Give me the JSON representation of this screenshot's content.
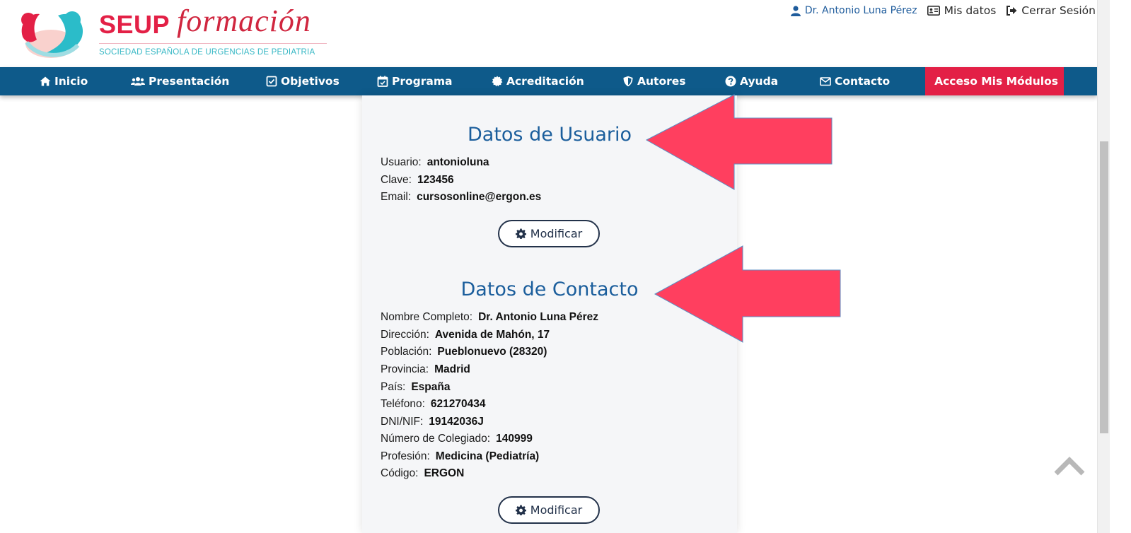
{
  "colors": {
    "brand_red": "#e32046",
    "nav_blue": "#0e5a8a",
    "title_blue": "#1b5e9c",
    "teal": "#35b7c4",
    "annotation_arrow": "#ff3f5f"
  },
  "logo": {
    "main": "SEUP",
    "script": "formación",
    "subtitle": "SOCIEDAD ESPAÑOLA DE URGENCIAS DE PEDIATRIA"
  },
  "user_bar": {
    "user_name": "Dr. Antonio Luna Pérez",
    "mis_datos": "Mis datos",
    "cerrar_sesion": "Cerrar Sesión",
    "icons": [
      "user-icon",
      "id-card-icon",
      "sign-out-icon"
    ]
  },
  "nav": {
    "items": [
      {
        "label": "Inicio",
        "icon": "home-icon"
      },
      {
        "label": "Presentación",
        "icon": "users-icon"
      },
      {
        "label": "Objetivos",
        "icon": "check-square-icon"
      },
      {
        "label": "Programa",
        "icon": "calendar-check-icon"
      },
      {
        "label": "Acreditación",
        "icon": "certificate-icon"
      },
      {
        "label": "Autores",
        "icon": "shield-icon"
      },
      {
        "label": "Ayuda",
        "icon": "question-circle-icon"
      },
      {
        "label": "Contacto",
        "icon": "envelope-icon"
      },
      {
        "label": "Acceso Mis Módulos",
        "icon": "hand-pointer-icon"
      }
    ]
  },
  "user_data": {
    "title": "Datos de Usuario",
    "fields": [
      {
        "label": "Usuario:",
        "value": "antonioluna"
      },
      {
        "label": "Clave:",
        "value": "123456"
      },
      {
        "label": "Email:",
        "value": "cursosonline@ergon.es"
      }
    ],
    "button": "Modificar"
  },
  "contact_data": {
    "title": "Datos de Contacto",
    "fields": [
      {
        "label": "Nombre Completo:",
        "value": "Dr. Antonio Luna Pérez"
      },
      {
        "label": "Dirección:",
        "value": "Avenida de Mahón, 17"
      },
      {
        "label": "Población:",
        "value": "Pueblonuevo (28320)"
      },
      {
        "label": "Provincia:",
        "value": "Madrid"
      },
      {
        "label": "País:",
        "value": "España"
      },
      {
        "label": "Teléfono:",
        "value": "621270434"
      },
      {
        "label": "DNI/NIF:",
        "value": "19142036J"
      },
      {
        "label": "Número de Colegiado:",
        "value": "140999"
      },
      {
        "label": "Profesión:",
        "value": "Medicina (Pediatría)"
      },
      {
        "label": "Código:",
        "value": "ERGON"
      }
    ],
    "button": "Modificar"
  }
}
